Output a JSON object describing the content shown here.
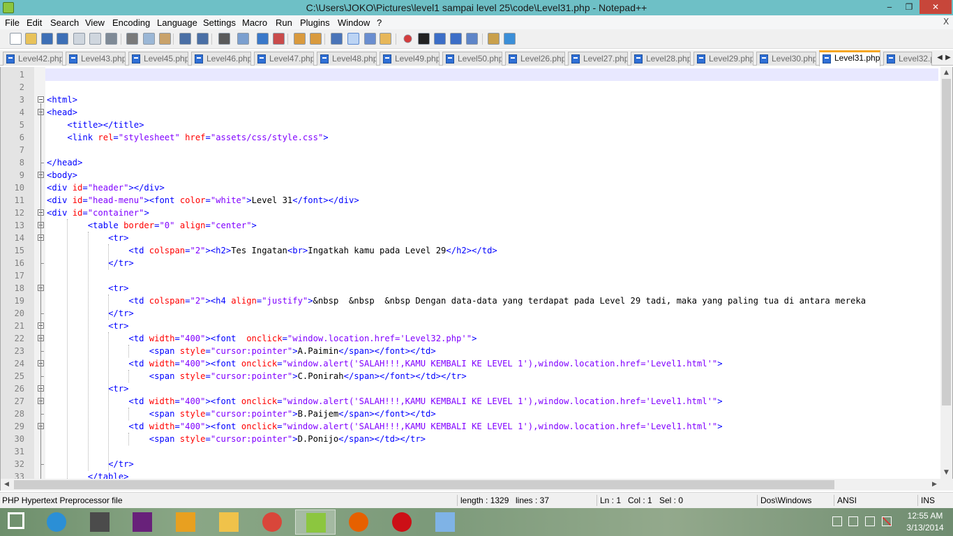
{
  "window": {
    "title": "C:\\Users\\JOKO\\Pictures\\level1 sampai level 25\\code\\Level31.php - Notepad++",
    "minimize_glyph": "‒",
    "maximize_glyph": "❐",
    "close_glyph": "✕"
  },
  "menu": {
    "items": [
      "File",
      "Edit",
      "Search",
      "View",
      "Encoding",
      "Language",
      "Settings",
      "Macro",
      "Run",
      "Plugins",
      "Window",
      "?"
    ],
    "close_glyph": "X"
  },
  "toolbar": {
    "icons": [
      "new-file-icon",
      "open-file-icon",
      "save-icon",
      "save-all-icon",
      "close-icon",
      "close-all-icon",
      "print-icon",
      "cut-icon",
      "copy-icon",
      "paste-icon",
      "undo-icon",
      "redo-icon",
      "find-icon",
      "replace-icon",
      "zoom-in-icon",
      "zoom-out-icon",
      "sync-vertical-icon",
      "sync-horizontal-icon",
      "word-wrap-icon",
      "show-all-characters-icon",
      "indent-guide-icon",
      "user-language-icon",
      "record-macro-icon",
      "stop-record-icon",
      "play-macro-icon",
      "run-macro-multiple-icon",
      "save-macro-icon",
      "function-list-icon",
      "spell-check-icon"
    ]
  },
  "tabs": [
    {
      "label": "Level42.php",
      "active": false
    },
    {
      "label": "Level43.php",
      "active": false
    },
    {
      "label": "Level45.php",
      "active": false
    },
    {
      "label": "Level46.php",
      "active": false
    },
    {
      "label": "Level47.php",
      "active": false
    },
    {
      "label": "Level48.php",
      "active": false
    },
    {
      "label": "Level49.php",
      "active": false
    },
    {
      "label": "Level50.php",
      "active": false
    },
    {
      "label": "Level26.php",
      "active": false
    },
    {
      "label": "Level27.php",
      "active": false
    },
    {
      "label": "Level28.php",
      "active": false
    },
    {
      "label": "Level29.php",
      "active": false
    },
    {
      "label": "Level30.php",
      "active": false
    },
    {
      "label": "Level31.php",
      "active": true
    },
    {
      "label": "Level32.p",
      "active": false
    }
  ],
  "tab_scroll": {
    "left": "◀",
    "right": "▶"
  },
  "colors": {
    "tag": "#0000ff",
    "attr": "#ff0000",
    "value": "#8000ff",
    "entity": "#000000",
    "text": "#000000",
    "current_line": "#e8e8ff"
  },
  "editor": {
    "current_line": 1,
    "lines": [
      {
        "n": "1",
        "fold": "",
        "segs": []
      },
      {
        "n": "2",
        "fold": "",
        "segs": []
      },
      {
        "n": "3",
        "fold": "open",
        "segs": [
          [
            "tag",
            "<html>"
          ]
        ]
      },
      {
        "n": "4",
        "fold": "open",
        "segs": [
          [
            "tag",
            "<head>"
          ]
        ]
      },
      {
        "n": "5",
        "fold": "",
        "segs": [
          [
            "text",
            "    "
          ],
          [
            "tag",
            "<title></title>"
          ]
        ]
      },
      {
        "n": "6",
        "fold": "",
        "segs": [
          [
            "text",
            "    "
          ],
          [
            "tag",
            "<link "
          ],
          [
            "attr",
            "rel"
          ],
          [
            "tag",
            "="
          ],
          [
            "value",
            "\"stylesheet\""
          ],
          [
            "text",
            " "
          ],
          [
            "attr",
            "href"
          ],
          [
            "tag",
            "="
          ],
          [
            "value",
            "\"assets/css/style.css\""
          ],
          [
            "tag",
            ">"
          ]
        ]
      },
      {
        "n": "7",
        "fold": "",
        "segs": []
      },
      {
        "n": "8",
        "fold": "end",
        "segs": [
          [
            "tag",
            "</head>"
          ]
        ]
      },
      {
        "n": "9",
        "fold": "open",
        "segs": [
          [
            "tag",
            "<body>"
          ]
        ]
      },
      {
        "n": "10",
        "fold": "",
        "segs": [
          [
            "tag",
            "<div "
          ],
          [
            "attr",
            "id"
          ],
          [
            "tag",
            "="
          ],
          [
            "value",
            "\"header\""
          ],
          [
            "tag",
            "></div>"
          ]
        ]
      },
      {
        "n": "11",
        "fold": "",
        "segs": [
          [
            "tag",
            "<div "
          ],
          [
            "attr",
            "id"
          ],
          [
            "tag",
            "="
          ],
          [
            "value",
            "\"head-menu\""
          ],
          [
            "tag",
            "><font "
          ],
          [
            "attr",
            "color"
          ],
          [
            "tag",
            "="
          ],
          [
            "value",
            "\"white\""
          ],
          [
            "tag",
            ">"
          ],
          [
            "text",
            "Level 31"
          ],
          [
            "tag",
            "</font></div>"
          ]
        ]
      },
      {
        "n": "12",
        "fold": "open",
        "segs": [
          [
            "tag",
            "<div "
          ],
          [
            "attr",
            "id"
          ],
          [
            "tag",
            "="
          ],
          [
            "value",
            "\"container\""
          ],
          [
            "tag",
            ">"
          ]
        ]
      },
      {
        "n": "13",
        "fold": "open",
        "segs": [
          [
            "text",
            "        "
          ],
          [
            "tag",
            "<table "
          ],
          [
            "attr",
            "border"
          ],
          [
            "tag",
            "="
          ],
          [
            "value",
            "\"0\""
          ],
          [
            "text",
            " "
          ],
          [
            "attr",
            "align"
          ],
          [
            "tag",
            "="
          ],
          [
            "value",
            "\"center\""
          ],
          [
            "tag",
            ">"
          ]
        ]
      },
      {
        "n": "14",
        "fold": "open",
        "segs": [
          [
            "text",
            "            "
          ],
          [
            "tag",
            "<tr>"
          ]
        ]
      },
      {
        "n": "15",
        "fold": "",
        "segs": [
          [
            "text",
            "                "
          ],
          [
            "tag",
            "<td "
          ],
          [
            "attr",
            "colspan"
          ],
          [
            "tag",
            "="
          ],
          [
            "value",
            "\"2\""
          ],
          [
            "tag",
            "><h2>"
          ],
          [
            "text",
            "Tes Ingatan"
          ],
          [
            "tag",
            "<br>"
          ],
          [
            "text",
            "Ingatkah kamu pada Level 29"
          ],
          [
            "tag",
            "</h2></td>"
          ]
        ]
      },
      {
        "n": "16",
        "fold": "end",
        "segs": [
          [
            "text",
            "            "
          ],
          [
            "tag",
            "</tr>"
          ]
        ]
      },
      {
        "n": "17",
        "fold": "",
        "segs": []
      },
      {
        "n": "18",
        "fold": "open",
        "segs": [
          [
            "text",
            "            "
          ],
          [
            "tag",
            "<tr>"
          ]
        ]
      },
      {
        "n": "19",
        "fold": "",
        "segs": [
          [
            "text",
            "                "
          ],
          [
            "tag",
            "<td "
          ],
          [
            "attr",
            "colspan"
          ],
          [
            "tag",
            "="
          ],
          [
            "value",
            "\"2\""
          ],
          [
            "tag",
            "><h4 "
          ],
          [
            "attr",
            "align"
          ],
          [
            "tag",
            "="
          ],
          [
            "value",
            "\"justify\""
          ],
          [
            "tag",
            ">"
          ],
          [
            "entity",
            "&nbsp  &nbsp  &nbsp"
          ],
          [
            "text",
            " Dengan data-data yang terdapat pada Level 29 tadi, maka yang paling tua di antara mereka"
          ]
        ]
      },
      {
        "n": "20",
        "fold": "end",
        "segs": [
          [
            "text",
            "            "
          ],
          [
            "tag",
            "</tr>"
          ]
        ]
      },
      {
        "n": "21",
        "fold": "open",
        "segs": [
          [
            "text",
            "            "
          ],
          [
            "tag",
            "<tr>"
          ]
        ]
      },
      {
        "n": "22",
        "fold": "open",
        "segs": [
          [
            "text",
            "                "
          ],
          [
            "tag",
            "<td "
          ],
          [
            "attr",
            "width"
          ],
          [
            "tag",
            "="
          ],
          [
            "value",
            "\"400\""
          ],
          [
            "tag",
            "><font  "
          ],
          [
            "attr",
            "onclick"
          ],
          [
            "tag",
            "="
          ],
          [
            "value",
            "\"window.location.href='Level32.php'\""
          ],
          [
            "tag",
            ">"
          ]
        ]
      },
      {
        "n": "23",
        "fold": "end",
        "segs": [
          [
            "text",
            "                    "
          ],
          [
            "tag",
            "<span "
          ],
          [
            "attr",
            "style"
          ],
          [
            "tag",
            "="
          ],
          [
            "value",
            "\"cursor:pointer\""
          ],
          [
            "tag",
            ">"
          ],
          [
            "text",
            "A.Paimin"
          ],
          [
            "tag",
            "</span></font></td>"
          ]
        ]
      },
      {
        "n": "24",
        "fold": "open",
        "segs": [
          [
            "text",
            "                "
          ],
          [
            "tag",
            "<td "
          ],
          [
            "attr",
            "width"
          ],
          [
            "tag",
            "="
          ],
          [
            "value",
            "\"400\""
          ],
          [
            "tag",
            "><font "
          ],
          [
            "attr",
            "onclick"
          ],
          [
            "tag",
            "="
          ],
          [
            "value",
            "\"window.alert('SALAH!!!,KAMU KEMBALI KE LEVEL 1'),window.location.href='Level1.html'\""
          ],
          [
            "tag",
            ">"
          ]
        ]
      },
      {
        "n": "25",
        "fold": "end",
        "segs": [
          [
            "text",
            "                    "
          ],
          [
            "tag",
            "<span "
          ],
          [
            "attr",
            "style"
          ],
          [
            "tag",
            "="
          ],
          [
            "value",
            "\"cursor:pointer\""
          ],
          [
            "tag",
            ">"
          ],
          [
            "text",
            "C.Ponirah"
          ],
          [
            "tag",
            "</span></font></td></tr>"
          ]
        ]
      },
      {
        "n": "26",
        "fold": "open",
        "segs": [
          [
            "text",
            "            "
          ],
          [
            "tag",
            "<tr>"
          ]
        ]
      },
      {
        "n": "27",
        "fold": "open",
        "segs": [
          [
            "text",
            "                "
          ],
          [
            "tag",
            "<td "
          ],
          [
            "attr",
            "width"
          ],
          [
            "tag",
            "="
          ],
          [
            "value",
            "\"400\""
          ],
          [
            "tag",
            "><font "
          ],
          [
            "attr",
            "onclick"
          ],
          [
            "tag",
            "="
          ],
          [
            "value",
            "\"window.alert('SALAH!!!,KAMU KEMBALI KE LEVEL 1'),window.location.href='Level1.html'\""
          ],
          [
            "tag",
            ">"
          ]
        ]
      },
      {
        "n": "28",
        "fold": "end",
        "segs": [
          [
            "text",
            "                    "
          ],
          [
            "tag",
            "<span "
          ],
          [
            "attr",
            "style"
          ],
          [
            "tag",
            "="
          ],
          [
            "value",
            "\"cursor:pointer\""
          ],
          [
            "tag",
            ">"
          ],
          [
            "text",
            "B.Paijem"
          ],
          [
            "tag",
            "</span></font></td>"
          ]
        ]
      },
      {
        "n": "29",
        "fold": "open",
        "segs": [
          [
            "text",
            "                "
          ],
          [
            "tag",
            "<td "
          ],
          [
            "attr",
            "width"
          ],
          [
            "tag",
            "="
          ],
          [
            "value",
            "\"400\""
          ],
          [
            "tag",
            "><font "
          ],
          [
            "attr",
            "onclick"
          ],
          [
            "tag",
            "="
          ],
          [
            "value",
            "\"window.alert('SALAH!!!,KAMU KEMBALI KE LEVEL 1'),window.location.href='Level1.html'\""
          ],
          [
            "tag",
            ">"
          ]
        ]
      },
      {
        "n": "30",
        "fold": "",
        "segs": [
          [
            "text",
            "                    "
          ],
          [
            "tag",
            "<span "
          ],
          [
            "attr",
            "style"
          ],
          [
            "tag",
            "="
          ],
          [
            "value",
            "\"cursor:pointer\""
          ],
          [
            "tag",
            ">"
          ],
          [
            "text",
            "D.Ponijo"
          ],
          [
            "tag",
            "</span></td></tr>"
          ]
        ]
      },
      {
        "n": "31",
        "fold": "",
        "segs": []
      },
      {
        "n": "32",
        "fold": "end",
        "segs": [
          [
            "text",
            "            "
          ],
          [
            "tag",
            "</tr>"
          ]
        ]
      },
      {
        "n": "33",
        "fold": "",
        "segs": [
          [
            "text",
            "        "
          ],
          [
            "tag",
            "</table>"
          ]
        ]
      }
    ]
  },
  "scroll": {
    "up": "▲",
    "down": "▼",
    "left": "◀",
    "right": "▶"
  },
  "status": {
    "file_type": "PHP Hypertext Preprocessor file",
    "length": "length : 1329",
    "lines": "lines : 37",
    "ln": "Ln : 1",
    "col": "Col : 1",
    "sel": "Sel : 0",
    "eol": "Dos\\Windows",
    "encoding": "ANSI",
    "mode": "INS"
  },
  "taskbar": {
    "apps": [
      {
        "name": "start-button",
        "icon": "windows-logo-icon",
        "active": false
      },
      {
        "name": "internet-explorer",
        "icon": "internet-explorer-icon",
        "active": false
      },
      {
        "name": "sublime-text",
        "icon": "sublime-text-icon",
        "active": false
      },
      {
        "name": "visual-studio",
        "icon": "visual-studio-icon",
        "active": false
      },
      {
        "name": "winamp",
        "icon": "winamp-icon",
        "active": false
      },
      {
        "name": "file-explorer",
        "icon": "folder-icon",
        "active": false
      },
      {
        "name": "chrome",
        "icon": "chrome-icon",
        "active": false
      },
      {
        "name": "notepad-plus-plus",
        "icon": "notepad-plus-plus-icon",
        "active": true
      },
      {
        "name": "firefox",
        "icon": "firefox-icon",
        "active": false
      },
      {
        "name": "opera",
        "icon": "opera-icon",
        "active": false
      },
      {
        "name": "paint",
        "icon": "paint-palette-icon",
        "active": false
      }
    ],
    "tray_icons": [
      "flag-icon",
      "network-icon",
      "signal-icon",
      "volume-muted-icon"
    ],
    "time": "12:55 AM",
    "date": "3/13/2014"
  }
}
